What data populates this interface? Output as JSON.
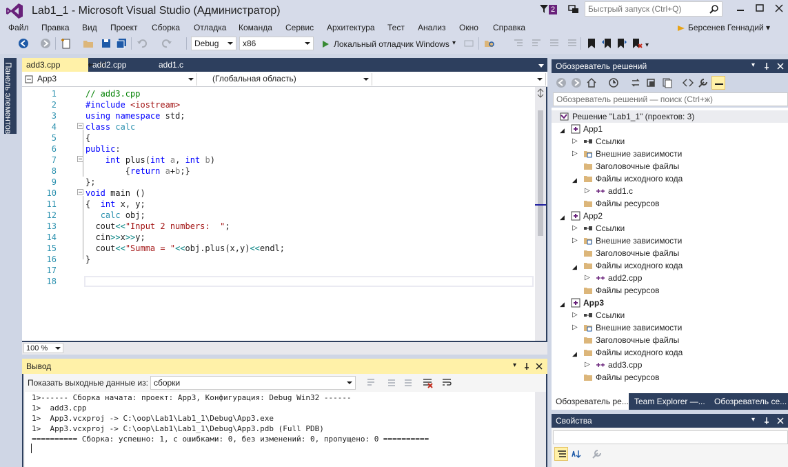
{
  "window": {
    "title": "Lab1_1 - Microsoft Visual Studio (Администратор)",
    "notification_count": "2",
    "quick_launch_placeholder": "Быстрый запуск (Ctrl+Q)"
  },
  "menu": {
    "items": [
      "Файл",
      "Правка",
      "Вид",
      "Проект",
      "Сборка",
      "Отладка",
      "Команда",
      "Сервис",
      "Архитектура",
      "Тест",
      "Анализ",
      "Окно",
      "Справка"
    ],
    "user": "Берсенев Геннадий"
  },
  "toolbar": {
    "configuration": "Debug",
    "platform": "x86",
    "start_debugger": "Локальный отладчик Windows"
  },
  "toolbox": {
    "label": "Панель элементов"
  },
  "editor": {
    "tabs": [
      {
        "label": "add3.cpp"
      },
      {
        "label": "add2.cpp"
      },
      {
        "label": "add1.c"
      }
    ],
    "nav": {
      "project": "App3",
      "scope": "(Глобальная область)",
      "member": ""
    },
    "zoom": "100 %",
    "line_numbers": [
      "1",
      "2",
      "3",
      "4",
      "5",
      "6",
      "7",
      "8",
      "9",
      "10",
      "11",
      "12",
      "13",
      "14",
      "15",
      "16",
      "17",
      "18"
    ],
    "code": [
      [
        {
          "t": "// add3.cpp",
          "c": "#008000"
        }
      ],
      [
        {
          "t": "#include ",
          "c": "#0000ff"
        },
        {
          "t": "<iostream>",
          "c": "#a31515"
        }
      ],
      [
        {
          "t": "using",
          "c": "#0000ff"
        },
        {
          "t": " ",
          "c": "#1e1e1e"
        },
        {
          "t": "namespace",
          "c": "#0000ff"
        },
        {
          "t": " std;",
          "c": "#1e1e1e"
        }
      ],
      [
        {
          "t": "class",
          "c": "#0000ff"
        },
        {
          "t": " ",
          "c": "#1e1e1e"
        },
        {
          "t": "calc",
          "c": "#2b91af"
        }
      ],
      [
        {
          "t": "{",
          "c": "#1e1e1e"
        }
      ],
      [
        {
          "t": "public",
          "c": "#0000ff"
        },
        {
          "t": ":",
          "c": "#1e1e1e"
        }
      ],
      [
        {
          "t": "    ",
          "c": "#1e1e1e"
        },
        {
          "t": "int",
          "c": "#0000ff"
        },
        {
          "t": " plus(",
          "c": "#1e1e1e"
        },
        {
          "t": "int",
          "c": "#0000ff"
        },
        {
          "t": " ",
          "c": "#1e1e1e"
        },
        {
          "t": "a",
          "c": "#808080"
        },
        {
          "t": ", ",
          "c": "#1e1e1e"
        },
        {
          "t": "int",
          "c": "#0000ff"
        },
        {
          "t": " ",
          "c": "#1e1e1e"
        },
        {
          "t": "b",
          "c": "#808080"
        },
        {
          "t": ")",
          "c": "#1e1e1e"
        }
      ],
      [
        {
          "t": "        {",
          "c": "#1e1e1e"
        },
        {
          "t": "return",
          "c": "#0000ff"
        },
        {
          "t": " ",
          "c": "#1e1e1e"
        },
        {
          "t": "a",
          "c": "#808080"
        },
        {
          "t": "+",
          "c": "#1e1e1e"
        },
        {
          "t": "b",
          "c": "#808080"
        },
        {
          "t": ";}",
          "c": "#1e1e1e"
        }
      ],
      [
        {
          "t": "};",
          "c": "#1e1e1e"
        }
      ],
      [
        {
          "t": "void",
          "c": "#0000ff"
        },
        {
          "t": " main ()",
          "c": "#1e1e1e"
        }
      ],
      [
        {
          "t": "{  ",
          "c": "#1e1e1e"
        },
        {
          "t": "int",
          "c": "#0000ff"
        },
        {
          "t": " x, y;",
          "c": "#1e1e1e"
        }
      ],
      [
        {
          "t": "   ",
          "c": "#1e1e1e"
        },
        {
          "t": "calc",
          "c": "#2b91af"
        },
        {
          "t": " obj;",
          "c": "#1e1e1e"
        }
      ],
      [
        {
          "t": "  cout",
          "c": "#1e1e1e"
        },
        {
          "t": "<<",
          "c": "#008080"
        },
        {
          "t": "\"Input 2 numbers:  \"",
          "c": "#a31515"
        },
        {
          "t": ";",
          "c": "#1e1e1e"
        }
      ],
      [
        {
          "t": "  cin",
          "c": "#1e1e1e"
        },
        {
          "t": ">>",
          "c": "#008080"
        },
        {
          "t": "x",
          "c": "#1e1e1e"
        },
        {
          "t": ">>",
          "c": "#008080"
        },
        {
          "t": "y;",
          "c": "#1e1e1e"
        }
      ],
      [
        {
          "t": "  cout",
          "c": "#1e1e1e"
        },
        {
          "t": "<<",
          "c": "#008080"
        },
        {
          "t": "\"Summa = \"",
          "c": "#a31515"
        },
        {
          "t": "<<",
          "c": "#008080"
        },
        {
          "t": "obj.plus(x,y)",
          "c": "#1e1e1e"
        },
        {
          "t": "<<",
          "c": "#008080"
        },
        {
          "t": "endl;",
          "c": "#1e1e1e"
        }
      ],
      [
        {
          "t": "}",
          "c": "#1e1e1e"
        }
      ],
      [
        {
          "t": "",
          "c": "#1e1e1e"
        }
      ],
      [
        {
          "t": "",
          "c": "#1e1e1e"
        }
      ]
    ]
  },
  "output": {
    "title": "Вывод",
    "show_from_label": "Показать выходные данные из:",
    "source": "сборки",
    "lines": [
      "1>------ Сборка начата: проект: App3, Конфигурация: Debug Win32 ------",
      "1>  add3.cpp",
      "1>  App3.vcxproj -> C:\\oop\\Lab1\\Lab1_1\\Debug\\App3.exe",
      "1>  App3.vcxproj -> C:\\oop\\Lab1\\Lab1_1\\Debug\\App3.pdb (Full PDB)",
      "========== Сборка: успешно: 1, с ошибками: 0, без изменений: 0, пропущено: 0 =========="
    ]
  },
  "solution_explorer": {
    "title": "Обозреватель решений",
    "search_placeholder": "Обозреватель решений — поиск (Ctrl+ж)",
    "solution": "Решение \"Lab1_1\" (проектов: 3)",
    "projects": [
      {
        "name": "App1",
        "children": [
          {
            "label": "Ссылки",
            "expander": "closed"
          },
          {
            "label": "Внешние зависимости",
            "expander": "closed"
          },
          {
            "label": "Заголовочные файлы",
            "expander": "none"
          },
          {
            "label": "Файлы исходного кода",
            "expander": "open",
            "file": "add1.c"
          },
          {
            "label": "Файлы ресурсов",
            "expander": "none"
          }
        ]
      },
      {
        "name": "App2",
        "children": [
          {
            "label": "Ссылки",
            "expander": "closed"
          },
          {
            "label": "Внешние зависимости",
            "expander": "closed"
          },
          {
            "label": "Заголовочные файлы",
            "expander": "none"
          },
          {
            "label": "Файлы исходного кода",
            "expander": "open",
            "file": "add2.cpp"
          },
          {
            "label": "Файлы ресурсов",
            "expander": "none"
          }
        ]
      },
      {
        "name": "App3",
        "children": [
          {
            "label": "Ссылки",
            "expander": "closed"
          },
          {
            "label": "Внешние зависимости",
            "expander": "closed"
          },
          {
            "label": "Заголовочные файлы",
            "expander": "none"
          },
          {
            "label": "Файлы исходного кода",
            "expander": "open",
            "file": "add3.cpp"
          },
          {
            "label": "Файлы ресурсов",
            "expander": "none"
          }
        ]
      }
    ],
    "tabs": [
      "Обозреватель ре...",
      "Team Explorer —...",
      "Обозреватель се..."
    ]
  },
  "properties": {
    "title": "Свойства"
  }
}
